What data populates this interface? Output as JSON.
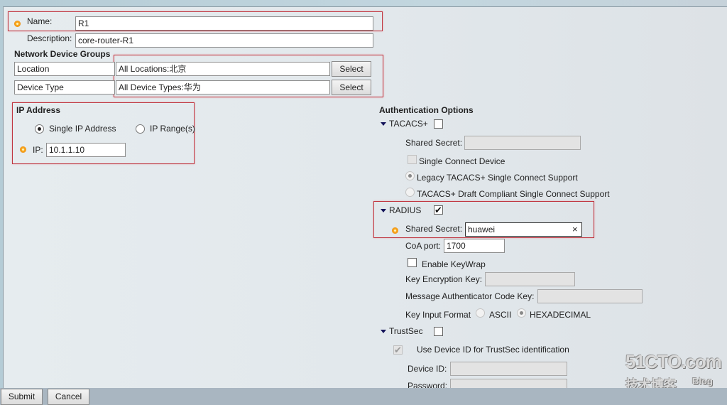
{
  "general": {
    "name_label": "Name:",
    "name_value": "R1",
    "description_label": "Description:",
    "description_value": "core-router-R1"
  },
  "ndg": {
    "title": "Network Device Groups",
    "rows": [
      {
        "group": "Location",
        "value": "All Locations:北京",
        "button": "Select"
      },
      {
        "group": "Device Type",
        "value": "All Device Types:华为",
        "button": "Select"
      }
    ]
  },
  "ip": {
    "title": "IP Address",
    "options": [
      "Single IP Address",
      "IP Range(s)"
    ],
    "selected": "Single IP Address",
    "ip_label": "IP:",
    "ip_value": "10.1.1.10"
  },
  "auth": {
    "title": "Authentication Options",
    "tacacs": {
      "label": "TACACS+",
      "checked": false,
      "shared_secret_label": "Shared Secret:",
      "shared_secret_value": "",
      "single_connect_label": "Single Connect Device",
      "legacy_label": "Legacy TACACS+ Single Connect Support",
      "draft_label": "TACACS+ Draft Compliant Single Connect Support"
    },
    "radius": {
      "label": "RADIUS",
      "checked": true,
      "shared_secret_label": "Shared Secret:",
      "shared_secret_value": "huawei",
      "clear_glyph": "×",
      "coa_label": "CoA port:",
      "coa_value": "1700",
      "keywrap_label": "Enable KeyWrap",
      "kek_label": "Key Encryption Key:",
      "mack_label": "Message Authenticator Code Key:",
      "key_format_label": "Key Input Format",
      "key_format_options": [
        "ASCII",
        "HEXADECIMAL"
      ],
      "key_format_selected": "HEXADECIMAL"
    },
    "trustsec": {
      "label": "TrustSec",
      "checked": false,
      "use_device_id_label": "Use Device ID for TrustSec identification",
      "device_id_label": "Device ID:",
      "password_label": "Password:"
    }
  },
  "footer": {
    "submit": "Submit",
    "cancel": "Cancel"
  },
  "watermark": {
    "line1": "51CTO.com",
    "line2": "技术博客",
    "line3": "Blog"
  },
  "glyphs": {
    "check": "✔"
  }
}
